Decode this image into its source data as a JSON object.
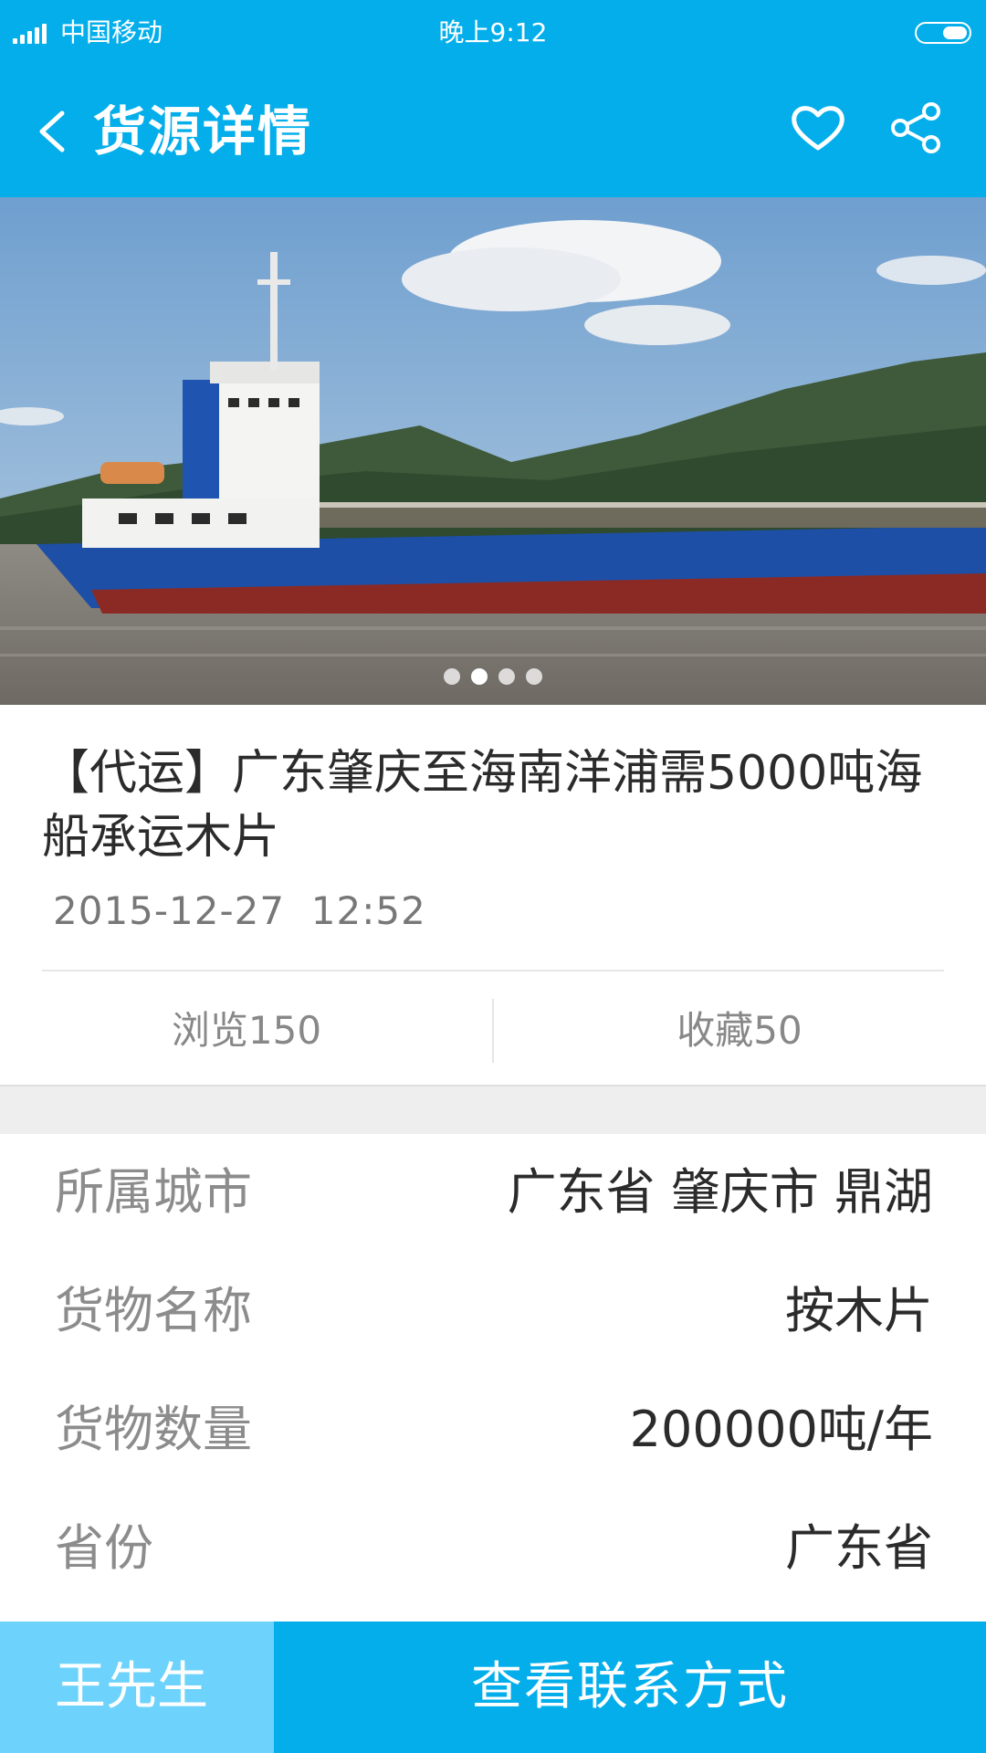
{
  "status_bar": {
    "carrier": "中国移动",
    "time": "晚上9:12"
  },
  "header": {
    "title": "货源详情",
    "icons": [
      "back-icon",
      "heart-icon",
      "share-icon"
    ]
  },
  "banner": {
    "image_description_icon": "cargo-ship-photo",
    "dots_count": 4,
    "active_dot_index": 1
  },
  "detail": {
    "title": "【代运】广东肇庆至海南洋浦需5000吨海船承运木片",
    "date": "2015-12-27",
    "time": "12:52",
    "views": "浏览150",
    "favorites": "收藏50"
  },
  "info_rows": [
    {
      "label": "所属城市",
      "value": "广东省 肇庆市 鼎湖"
    },
    {
      "label": "货物名称",
      "value": "按木片"
    },
    {
      "label": "货物数量",
      "value": "200000吨/年"
    },
    {
      "label": "省份",
      "value": "广东省"
    }
  ],
  "bottom_bar": {
    "contact_name": "王先生",
    "contact_button": "查看联系方式"
  },
  "colors": {
    "primary": "#03AEEB",
    "secondary": "#6DD3FC",
    "text_dark": "#2b2b2b",
    "text_gray": "#8c8c8c"
  }
}
